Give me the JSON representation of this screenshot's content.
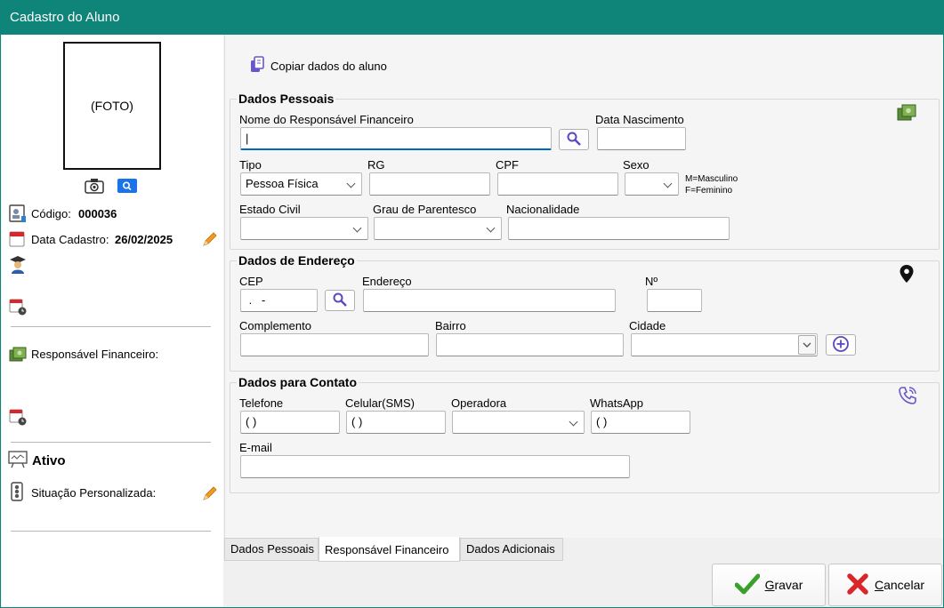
{
  "window": {
    "title": "Cadastro do Aluno"
  },
  "left": {
    "photo_placeholder": "(FOTO)",
    "codigo_label": "Código:",
    "codigo_value": "000036",
    "data_cadastro_label": "Data Cadastro:",
    "data_cadastro_value": "26/02/2025",
    "responsavel_label": "Responsável Financeiro:",
    "status_value": "Ativo",
    "situacao_label": "Situação Personalizada:"
  },
  "toolbar": {
    "copy_label": "Copiar dados do aluno"
  },
  "dados_pessoais": {
    "title": "Dados Pessoais",
    "nome_label": "Nome do Responsável Financeiro",
    "nome_value": "|",
    "data_nascimento_label": "Data Nascimento",
    "tipo_label": "Tipo",
    "tipo_value": "Pessoa Física",
    "rg_label": "RG",
    "cpf_label": "CPF",
    "sexo_label": "Sexo",
    "sexo_hint_m": "M=Masculino",
    "sexo_hint_f": "F=Feminino",
    "estado_civil_label": "Estado Civil",
    "grau_label": "Grau de Parentesco",
    "nacionalidade_label": "Nacionalidade"
  },
  "endereco": {
    "title": "Dados de Endereço",
    "cep_label": "CEP",
    "cep_value": " .   -",
    "endereco_label": "Endereço",
    "numero_label": "Nº",
    "complemento_label": "Complemento",
    "bairro_label": "Bairro",
    "cidade_label": "Cidade"
  },
  "contato": {
    "title": "Dados para Contato",
    "telefone_label": "Telefone",
    "telefone_value": "( )",
    "celular_label": "Celular(SMS)",
    "celular_value": "( )",
    "operadora_label": "Operadora",
    "whatsapp_label": "WhatsApp",
    "whatsapp_value": "( )",
    "email_label": "E-mail"
  },
  "tabs": [
    "Dados Pessoais",
    "Responsável Financeiro",
    "Dados Adicionais"
  ],
  "footer": {
    "gravar_first": "G",
    "gravar_rest": "ravar",
    "cancelar_first": "C",
    "cancelar_rest": "ancelar"
  },
  "colors": {
    "titlebar": "#0f8478",
    "focus": "#0067c0",
    "accent_blue": "#1a73e8",
    "cancel_red": "#d9262b",
    "ok_green": "#3aa02c"
  }
}
